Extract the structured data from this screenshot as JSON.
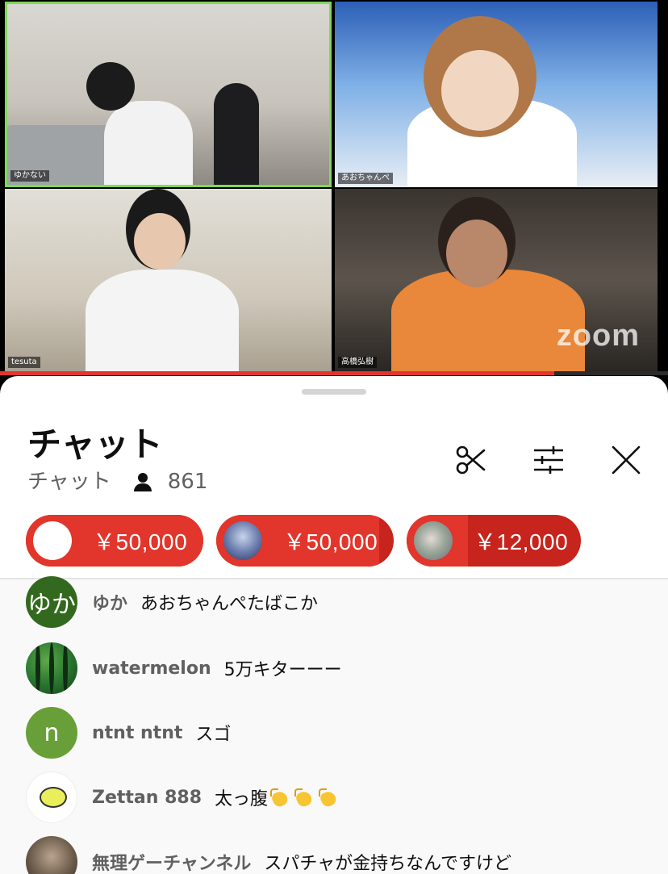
{
  "video": {
    "participants": [
      {
        "name": "ゆかない"
      },
      {
        "name": "あおちゃんぺ"
      },
      {
        "name": "tesuta"
      },
      {
        "name": "高橋弘樹"
      }
    ],
    "watermark": "zoom",
    "progress_fraction": 0.83
  },
  "chat": {
    "title": "チャット",
    "subtitle": "チャット",
    "viewer_count": "861",
    "icons": {
      "clip": "scissors-icon",
      "filter": "tune-icon",
      "close": "close-icon",
      "viewers": "person-icon"
    },
    "tickers": [
      {
        "amount": "￥50,000",
        "fill_fraction": 1.0
      },
      {
        "amount": "￥50,000",
        "fill_fraction": 0.92
      },
      {
        "amount": "￥12,000",
        "fill_fraction": 0.35
      }
    ],
    "messages": [
      {
        "avatar_text": "ゆか",
        "author": "ゆか",
        "text": "あおちゃんぺたばこか"
      },
      {
        "avatar_text": "",
        "author": "watermelon",
        "text": "5万キターーー"
      },
      {
        "avatar_text": "n",
        "author": "ntnt ntnt",
        "text": "スゴ"
      },
      {
        "avatar_text": "",
        "author": "Zettan 888",
        "text": "太っ腹"
      },
      {
        "avatar_text": "",
        "author": "無理ゲーチャンネル",
        "text": "スパチャが金持ちなんですけど"
      }
    ],
    "colors": {
      "superchat_dark": "#c6241c",
      "superchat_light": "#e2352b",
      "progress": "#e3342f"
    }
  }
}
